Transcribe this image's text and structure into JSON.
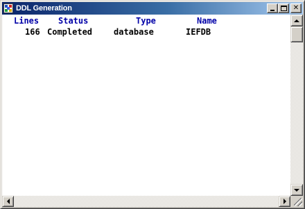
{
  "window": {
    "title": "DDL Generation",
    "icon": "app-grid-icon",
    "buttons": {
      "minimize": "minimize-icon",
      "maximize": "maximize-icon",
      "close_label": "✕"
    }
  },
  "table": {
    "columns": [
      "Lines",
      "Status",
      "Type",
      "Name"
    ],
    "rows": [
      {
        "lines": "166",
        "status": "Completed",
        "type": "database",
        "name": "IEFDB"
      }
    ]
  },
  "colors": {
    "header_text": "#0000a8",
    "body_text": "#000000",
    "titlebar_start": "#0a246a",
    "titlebar_end": "#a6caf0"
  }
}
